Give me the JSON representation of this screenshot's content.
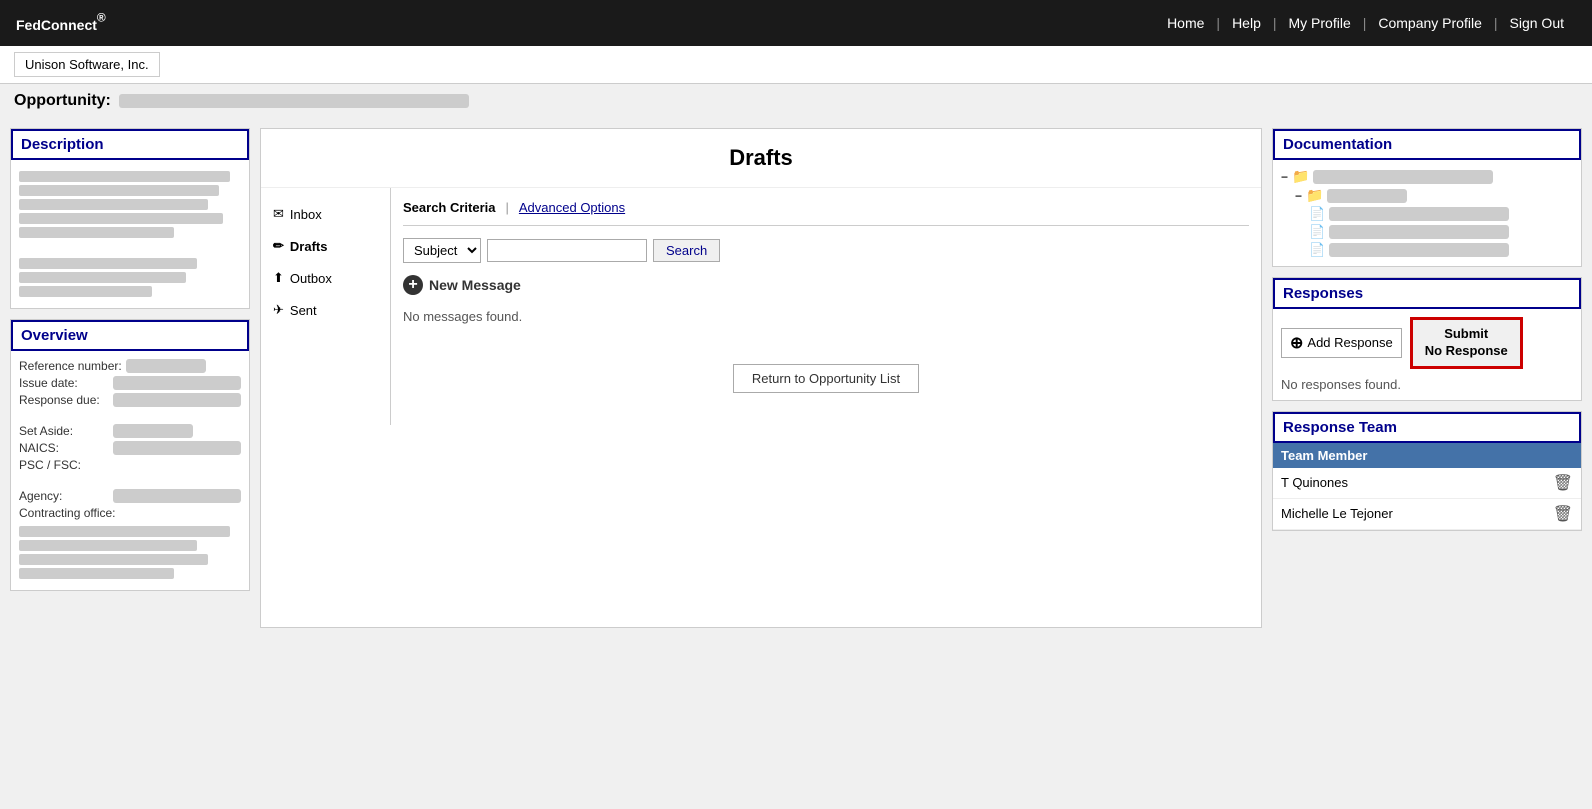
{
  "nav": {
    "brand": "FedConnect",
    "brand_suffix": "®",
    "links": [
      "Home",
      "Help",
      "My Profile",
      "Company Profile",
      "Sign Out"
    ]
  },
  "subheader": {
    "company": "Unison Software, Inc."
  },
  "opportunity": {
    "label": "Opportunity:"
  },
  "description_panel": {
    "title": "Description"
  },
  "overview_panel": {
    "title": "Overview",
    "fields": [
      {
        "label": "Reference number:",
        "value": ""
      },
      {
        "label": "Issue date:",
        "value": ""
      },
      {
        "label": "Response due:",
        "value": ""
      },
      {
        "label": "Set Aside:",
        "value": ""
      },
      {
        "label": "NAICS:",
        "value": ""
      },
      {
        "label": "PSC / FSC:",
        "value": ""
      },
      {
        "label": "Agency:",
        "value": ""
      },
      {
        "label": "Contracting office:",
        "value": ""
      }
    ]
  },
  "drafts": {
    "title": "Drafts",
    "sidebar": [
      {
        "label": "Inbox",
        "icon": "inbox"
      },
      {
        "label": "Drafts",
        "icon": "drafts",
        "active": true
      },
      {
        "label": "Outbox",
        "icon": "outbox"
      },
      {
        "label": "Sent",
        "icon": "sent"
      }
    ],
    "search": {
      "criteria_label": "Search Criteria",
      "advanced_options": "Advanced Options",
      "subject_option": "Subject",
      "search_button": "Search",
      "search_placeholder": ""
    },
    "new_message_label": "New Message",
    "no_messages": "No messages found.",
    "return_button": "Return to Opportunity List"
  },
  "documentation": {
    "title": "Documentation",
    "tree": [
      {
        "level": 0,
        "type": "folder",
        "label": ""
      },
      {
        "level": 1,
        "type": "folder",
        "label": ""
      },
      {
        "level": 2,
        "type": "doc",
        "label": ""
      },
      {
        "level": 2,
        "type": "doc",
        "label": ""
      },
      {
        "level": 2,
        "type": "doc",
        "label": ""
      }
    ]
  },
  "responses": {
    "title": "Responses",
    "add_response_label": "Add Response",
    "submit_no_response_label": "Submit\nNo Response",
    "no_responses": "No responses found."
  },
  "response_team": {
    "title": "Response Team",
    "column_label": "Team Member",
    "members": [
      {
        "name": "T Quinones"
      },
      {
        "name": "Michelle Le Tejoner"
      }
    ]
  }
}
